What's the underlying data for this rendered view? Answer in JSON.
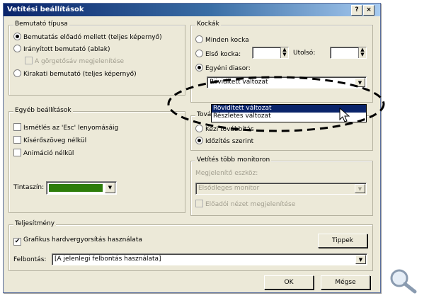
{
  "window": {
    "title": "Vetítési beállítások",
    "help_label": "?",
    "close_label": "×"
  },
  "show_type": {
    "legend": "Bemutató típusa",
    "speaker": "Bemutatás előadó mellett (teljes képernyő)",
    "individual": "Irányított bemutató (ablak)",
    "scrollbar": "A görgetősáv megjelenítése",
    "kiosk": "Kirakati bemutató (teljes képernyő)"
  },
  "other": {
    "legend": "Egyéb beállítások",
    "loop": "Ismétlés az 'Esc' lenyomásáig",
    "no_narration": "Kísérőszöveg nélkül",
    "no_animation": "Animáció nélkül",
    "pen_color_label": "Tintaszín:",
    "pen_color": "#2e7d0a"
  },
  "slides": {
    "legend": "Kockák",
    "all": "Minden kocka",
    "from": "Első kocka:",
    "to": "Utolsó:",
    "custom": "Egyéni diasor:",
    "custom_value": "Rövidített változat",
    "options": [
      "Rövidített változat",
      "Részletes változat"
    ]
  },
  "advance": {
    "legend": "Továbbítás",
    "manual": "Kézi továbbítás",
    "timings": "Időzítés szerint"
  },
  "multi_monitor": {
    "legend": "Vetítés több monitoron",
    "display_label": "Megjelenítő eszköz:",
    "display_value": "Elsődleges monitor",
    "presenter_view": "Előadói nézet megjelenítése"
  },
  "performance": {
    "legend": "Teljesítmény",
    "hw_accel": "Grafikus hardvergyorsítás használata",
    "tips_label": "Tippek",
    "resolution_label": "Felbontás:",
    "resolution_value": "[A jelenlegi felbontás használata]"
  },
  "buttons": {
    "ok": "OK",
    "cancel": "Mégse"
  },
  "zoom_icon": "magnifier-icon"
}
